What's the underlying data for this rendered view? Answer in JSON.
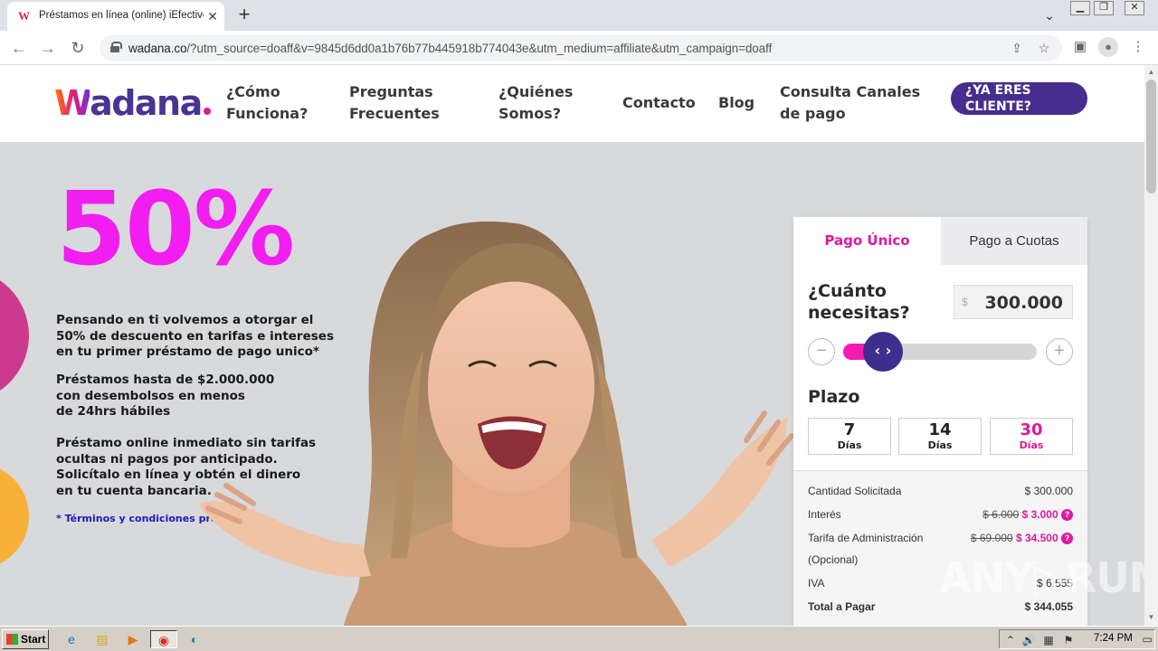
{
  "browser": {
    "tab_title": "Préstamos en línea (online) iEfectivo",
    "tab_favicon": "W",
    "close_icon": "✕",
    "new_tab_icon": "+",
    "url_host": "wadana.co",
    "url_rest": "/?utm_source=doaff&v=9845d6dd0a1b76b77b445918b774043e&utm_medium=affiliate&utm_campaign=doaff"
  },
  "site": {
    "logo_text": "adana",
    "logo_w": "W",
    "nav": [
      {
        "line1": "¿Cómo",
        "line2": "Funciona?"
      },
      {
        "line1": "Preguntas",
        "line2": "Frecuentes"
      },
      {
        "line1": "¿Quiénes",
        "line2": "Somos?"
      },
      {
        "line1": "Contacto"
      },
      {
        "line1": "Blog"
      },
      {
        "line1": "Consulta Canales",
        "line2": "de pago"
      }
    ],
    "cta_line1": "¿YA ERES",
    "cta_line2": "CLIENTE?"
  },
  "hero": {
    "headline": "50%",
    "para1": [
      "Pensando en ti volvemos a otorgar el",
      "50% de descuento en tarifas e intereses",
      "en tu primer préstamo de pago unico*"
    ],
    "para2": [
      "Préstamos hasta de $2.000.000",
      "con desembolsos en menos",
      "de 24hrs hábiles"
    ],
    "para3": [
      "Préstamo online inmediato sin tarifas",
      "ocultas ni pagos por anticipado.",
      "Solicítalo en línea y obtén el dinero",
      "en tu cuenta bancaria."
    ],
    "promo_link": "* Términos y condiciones promoción"
  },
  "calculator": {
    "tab_active": "Pago Único",
    "tab_other": "Pago a Cuotas",
    "question_line1": "¿Cuánto",
    "question_line2": "necesitas?",
    "currency": "$",
    "amount": "300.000",
    "slider_fraction": 0.2,
    "minus": "−",
    "plus": "+",
    "knob": "‹ ›",
    "plazo_label": "Plazo",
    "days": [
      {
        "n": "7",
        "d": "Días",
        "selected": false
      },
      {
        "n": "14",
        "d": "Días",
        "selected": false
      },
      {
        "n": "30",
        "d": "Días",
        "selected": true
      }
    ],
    "summary": {
      "cantidad_label": "Cantidad Solicitada",
      "cantidad_value": "$ 300.000",
      "interes_label": "Interés",
      "interes_old": "$ 6.000",
      "interes_new": "$ 3.000",
      "tarifa_label": "Tarifa de Administración",
      "tarifa_sub": "(Opcional)",
      "tarifa_old": "$ 69.000",
      "tarifa_new": "$ 34.500",
      "iva_label": "IVA",
      "iva_value": "$ 6.555",
      "total_label": "Total a Pagar",
      "total_value": "$ 344.055"
    }
  },
  "watermark": "ANY▷RUN",
  "taskbar": {
    "start_label": "Start",
    "clock": "7:24 PM"
  },
  "colors": {
    "brand_purple": "#452e8d",
    "brand_pink": "#e0189f",
    "headline_magenta": "#f21df0"
  }
}
